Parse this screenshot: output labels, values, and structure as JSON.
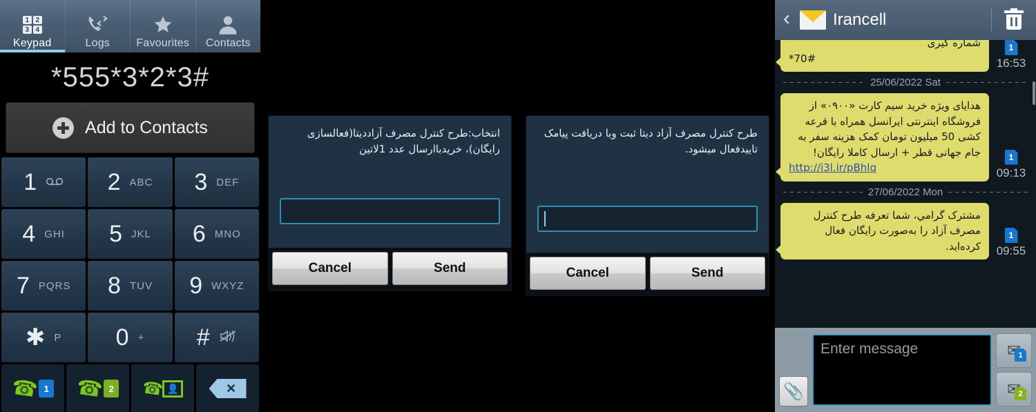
{
  "dialer": {
    "tabs": [
      {
        "label": "Keypad",
        "icon": "keypad-grid-icon",
        "active": true,
        "grid": [
          "1",
          "2",
          "3",
          "4"
        ]
      },
      {
        "label": "Logs",
        "icon": "call-logs-icon",
        "active": false
      },
      {
        "label": "Favourites",
        "icon": "star-icon",
        "active": false
      },
      {
        "label": "Contacts",
        "icon": "person-icon",
        "active": false
      }
    ],
    "dialed_number": "*555*3*2*3#",
    "add_to_contacts_label": "Add to Contacts",
    "keys": [
      {
        "digit": "1",
        "sub": "",
        "glyph": "∘∘",
        "icon": "voicemail-icon"
      },
      {
        "digit": "2",
        "sub": "ABC",
        "glyph": ""
      },
      {
        "digit": "3",
        "sub": "DEF",
        "glyph": ""
      },
      {
        "digit": "4",
        "sub": "GHI",
        "glyph": ""
      },
      {
        "digit": "5",
        "sub": "JKL",
        "glyph": ""
      },
      {
        "digit": "6",
        "sub": "MNO",
        "glyph": ""
      },
      {
        "digit": "7",
        "sub": "PQRS",
        "glyph": ""
      },
      {
        "digit": "8",
        "sub": "TUV",
        "glyph": ""
      },
      {
        "digit": "9",
        "sub": "WXYZ",
        "glyph": ""
      },
      {
        "digit": "✱",
        "sub": "P",
        "glyph": ""
      },
      {
        "digit": "0",
        "sub": "+",
        "glyph": ""
      },
      {
        "digit": "#",
        "sub": "",
        "glyph": "⌇",
        "icon": "mute-icon"
      }
    ],
    "actions": [
      {
        "name": "call-sim1",
        "sim": "1"
      },
      {
        "name": "call-sim2",
        "sim": "2"
      },
      {
        "name": "video-call",
        "sim": ""
      },
      {
        "name": "backspace",
        "sim": ""
      }
    ]
  },
  "dialog1": {
    "message": "انتخاب:طرح کنترل مصرف آزاددیتا(فعالسازی رایگان)، خریدباارسال عدد 1لاتین",
    "input_value": "",
    "cancel_label": "Cancel",
    "send_label": "Send"
  },
  "dialog2": {
    "message": "طرح کنترل مصرف آزاد دیتا ثبت وبا دریافت پیامک تاییدفعال میشود.",
    "input_value": "",
    "cancel_label": "Cancel",
    "send_label": "Send"
  },
  "sms": {
    "title": "Irancell",
    "messages": [
      {
        "date_separator": null,
        "text_rtl": "شماره گیری",
        "text_ltr": "*70#",
        "link": null,
        "sim": "1",
        "time": "16:53"
      },
      {
        "date_separator": "25/06/2022 Sat",
        "text_rtl": "هدایای ویژه خرید سیم کارت «۰۹۰۰» از فروشگاه اینترنتی ایرانسل همراه با قرعه کشی 50 میلیون تومان کمک هزینه سفر به جام جهانی قطر + ارسال کاملا رایگان!",
        "text_ltr": null,
        "link": "http://i3l.ir/pBhlq",
        "sim": "1",
        "time": "09:13"
      },
      {
        "date_separator": "27/06/2022 Mon",
        "text_rtl": "مشترک گرامي، شما تعرفه  طرح کنترل مصرف آزاد  را به‌صورت رایگان فعال کرده‌اید.",
        "text_ltr": null,
        "link": null,
        "sim": "1",
        "time": "09:55"
      }
    ],
    "composer": {
      "placeholder": "Enter message",
      "value": "",
      "attach_icon": "paperclip-icon",
      "send_buttons": [
        {
          "name": "send-sim1",
          "sim": "1"
        },
        {
          "name": "send-sim2",
          "sim": "2"
        }
      ]
    }
  },
  "colors": {
    "tabbar": "#4a5e73",
    "key": "#24374a",
    "dialog_bg": "#1e3243",
    "input_border": "#2f8fb8",
    "bubble": "#dfdc6e",
    "sim1": "#1878d0",
    "sim2": "#7cb024",
    "green": "#7cc720",
    "composer_bg": "#8d9ba4"
  }
}
